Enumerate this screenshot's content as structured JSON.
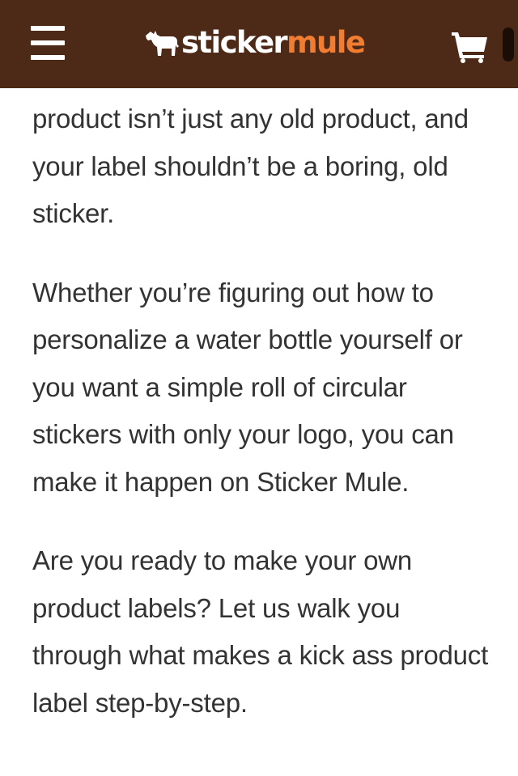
{
  "header": {
    "brand": {
      "word1": "sticker",
      "word2": "mule"
    },
    "menu_icon": "hamburger-menu-icon",
    "logo_icon": "mule-icon",
    "cart_icon": "shopping-cart-icon",
    "colors": {
      "bar": "#4d2a18",
      "brand_accent": "#f07d32",
      "icons": "#ffffff"
    }
  },
  "article": {
    "paragraphs": [
      "product isn’t just any old product, and your label shouldn’t be a boring, old sticker.",
      "Whether you’re figuring out how to personalize a water bottle yourself or you want a simple roll of circular stickers with only your logo, you can make it happen on Sticker Mule.",
      "Are you ready to make your own product labels? Let us walk you through what makes a kick ass product label step-by-step."
    ],
    "text_color": "#333333"
  }
}
